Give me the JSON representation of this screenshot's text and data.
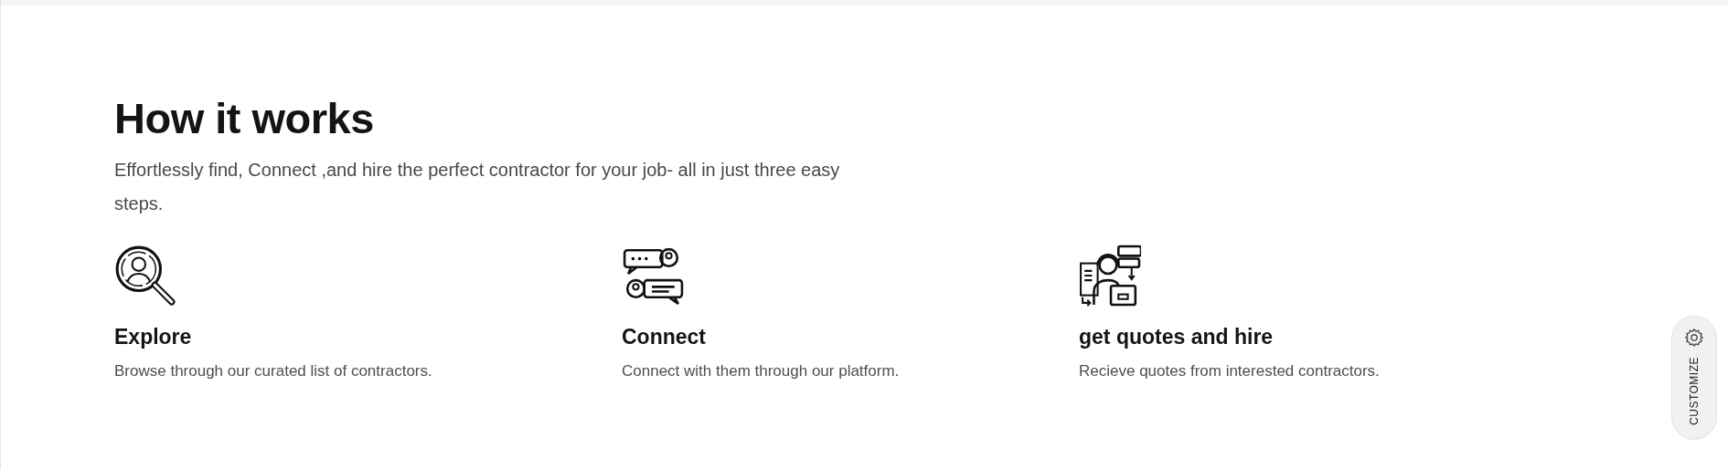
{
  "section": {
    "title": "How it works",
    "subtitle": "Effortlessly find, Connect ,and hire the perfect contractor for your job- all in just three easy steps."
  },
  "steps": [
    {
      "kind": "explore",
      "title": "Explore",
      "text": "Browse through our curated list of contractors."
    },
    {
      "kind": "connect",
      "title": "Connect",
      "text": "Connect with them through our platform."
    },
    {
      "kind": "hire",
      "title": "get quotes and hire",
      "text": "Recieve quotes from interested contractors."
    }
  ],
  "customize_button": {
    "label": "CUSTOMIZE"
  }
}
